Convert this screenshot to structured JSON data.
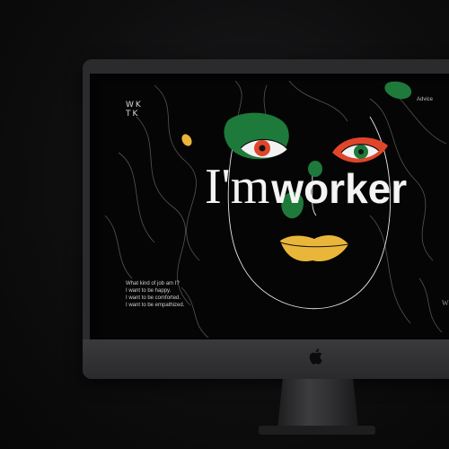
{
  "site": {
    "logo_line1": "WK",
    "logo_line2": "TK",
    "nav_link": "Advice"
  },
  "hero": {
    "headline_serif": "I'm",
    "headline_sans": "worker",
    "intro_lines": [
      "What kind of job am I?",
      "I want to be happy.",
      "I want to be comforted.",
      "I want to be empathized."
    ],
    "edge_letter": "W"
  },
  "colors": {
    "green": "#1e7a3a",
    "red": "#e0452a",
    "yellow": "#e9b63a",
    "background": "#050505"
  },
  "icons": [
    "apple-logo-icon"
  ]
}
